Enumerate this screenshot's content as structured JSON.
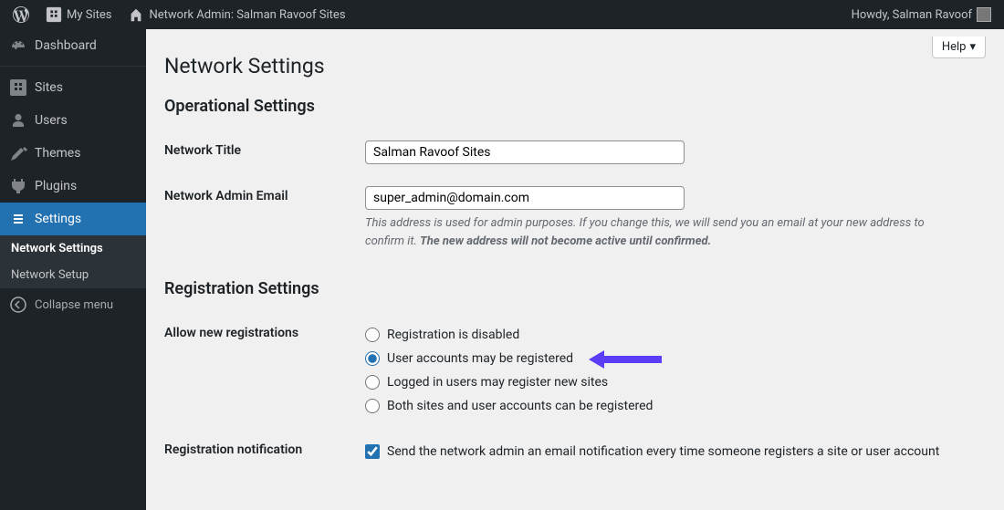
{
  "adminbar": {
    "my_sites": "My Sites",
    "network_admin": "Network Admin: Salman Ravoof Sites",
    "howdy": "Howdy, Salman Ravoof"
  },
  "sidebar": {
    "dashboard": "Dashboard",
    "sites": "Sites",
    "users": "Users",
    "themes": "Themes",
    "plugins": "Plugins",
    "settings": "Settings",
    "submenu": {
      "network_settings": "Network Settings",
      "network_setup": "Network Setup"
    },
    "collapse": "Collapse menu"
  },
  "content": {
    "help": "Help",
    "page_title": "Network Settings",
    "section_operational": "Operational Settings",
    "network_title_label": "Network Title",
    "network_title_value": "Salman Ravoof Sites",
    "admin_email_label": "Network Admin Email",
    "admin_email_value": "super_admin@domain.com",
    "admin_email_desc_a": "This address is used for admin purposes. If you change this, we will send you an email at your new address to confirm it. ",
    "admin_email_desc_b": "The new address will not become active until confirmed.",
    "section_registration": "Registration Settings",
    "allow_reg_label": "Allow new registrations",
    "reg_opt_1": "Registration is disabled",
    "reg_opt_2": "User accounts may be registered",
    "reg_opt_3": "Logged in users may register new sites",
    "reg_opt_4": "Both sites and user accounts can be registered",
    "reg_notif_label": "Registration notification",
    "reg_notif_text": "Send the network admin an email notification every time someone registers a site or user account"
  }
}
